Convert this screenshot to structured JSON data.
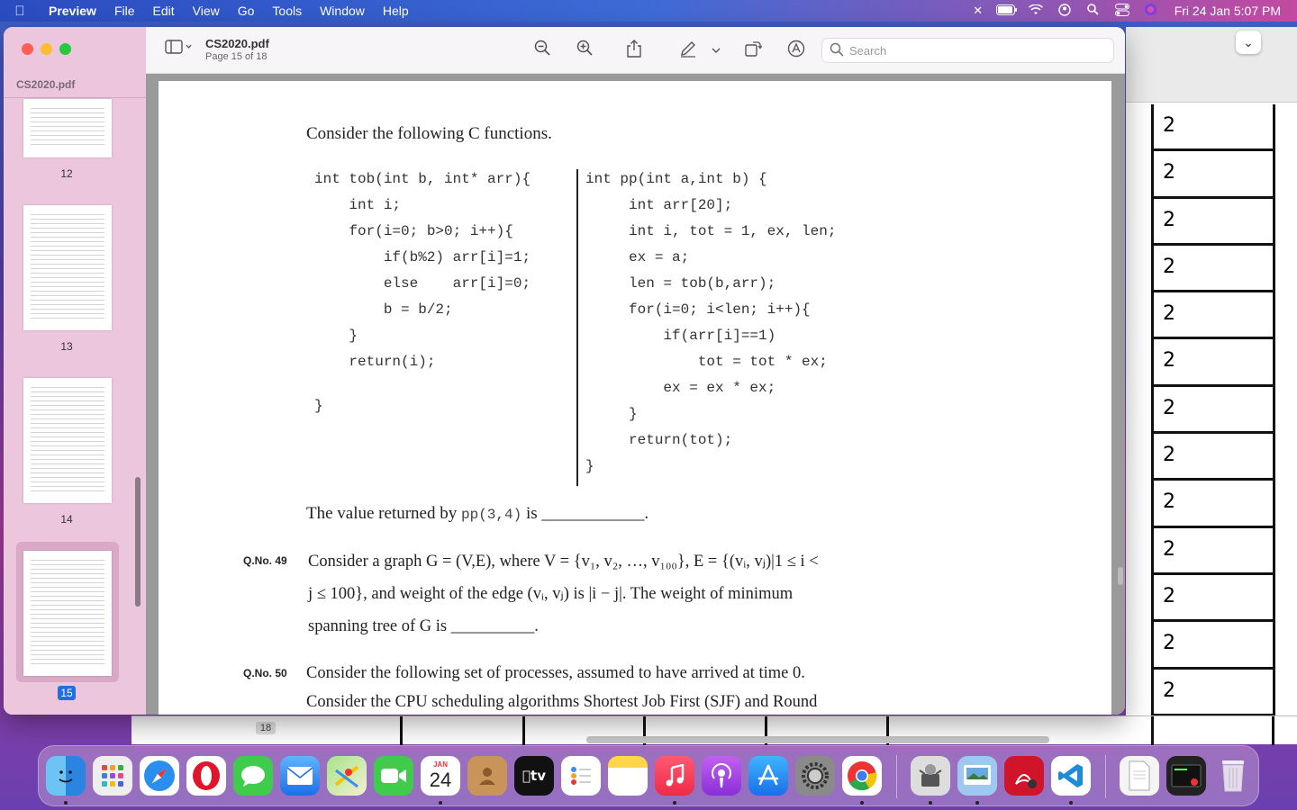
{
  "menubar": {
    "app_name": "Preview",
    "menus": [
      "File",
      "Edit",
      "View",
      "Go",
      "Tools",
      "Window",
      "Help"
    ],
    "clock": "Fri 24 Jan  5:07 PM"
  },
  "window": {
    "doc_title": "CS2020.pdf",
    "file_name": "CS2020.pdf",
    "page_info": "Page 15 of 18",
    "search_placeholder": "Search"
  },
  "thumbnails": [
    {
      "label": "12",
      "selected": false
    },
    {
      "label": "13",
      "selected": false
    },
    {
      "label": "14",
      "selected": false
    },
    {
      "label": "15",
      "selected": true
    }
  ],
  "page": {
    "intro": "Consider the following C functions.",
    "code_left": [
      "int tob(int b, int* arr){",
      "    int i;",
      "    for(i=0; b>0; i++){",
      "        if(b%2) arr[i]=1;",
      "        else    arr[i]=0;",
      "        b = b/2;",
      "    }",
      "    return(i);",
      "",
      "}"
    ],
    "code_right": [
      "int pp(int a,int b) {",
      "     int arr[20];",
      "     int i, tot = 1, ex, len;",
      "     ex = a;",
      "     len = tob(b,arr);",
      "     for(i=0; i<len; i++){",
      "         if(arr[i]==1)",
      "             tot = tot * ex;",
      "         ex = ex * ex;",
      "     }",
      "     return(tot);",
      "}"
    ],
    "q48_prefix": "The value returned by",
    "q48_call": "pp(3,4)",
    "q48_suffix": "is ____________.",
    "q49_no": "Q.No. 49",
    "q49_line1": "Consider a graph G = (V,E), where V = {v₁, v₂, …, v₁₀₀}, E = {(vᵢ, vⱼ)|1 ≤ i <",
    "q49_line2": "j ≤ 100}, and weight of the edge (vᵢ, vⱼ) is |i − j|. The weight of minimum",
    "q49_line3": "spanning tree of G is __________.",
    "q50_no": "Q.No. 50",
    "q50_line1": "Consider the following set of processes, assumed to have arrived at time 0.",
    "q50_line2": "Consider the CPU scheduling algorithms Shortest Job First (SJF) and Round"
  },
  "background_doc": {
    "cells": [
      "2",
      "2",
      "2",
      "2",
      "2",
      "2",
      "2",
      "2",
      "2",
      "2",
      "2",
      "2",
      "2"
    ],
    "page_badge": "18"
  },
  "dock": {
    "calendar_month": "JAN",
    "calendar_day": "24",
    "apps": [
      "finder-icon",
      "launchpad-icon",
      "safari-icon",
      "opera-icon",
      "messages-icon",
      "mail-icon",
      "maps-icon",
      "facetime-icon",
      "calendar-icon",
      "contacts-icon",
      "appletv-icon",
      "reminders-icon",
      "notes-icon",
      "music-icon",
      "podcasts-icon",
      "appstore-icon",
      "settings-icon",
      "chrome-icon",
      "automator-icon",
      "preview-icon",
      "acrobat-icon",
      "vscode-icon",
      "document-icon",
      "terminal-icon",
      "trash-icon"
    ],
    "appletv_label": "tv"
  }
}
